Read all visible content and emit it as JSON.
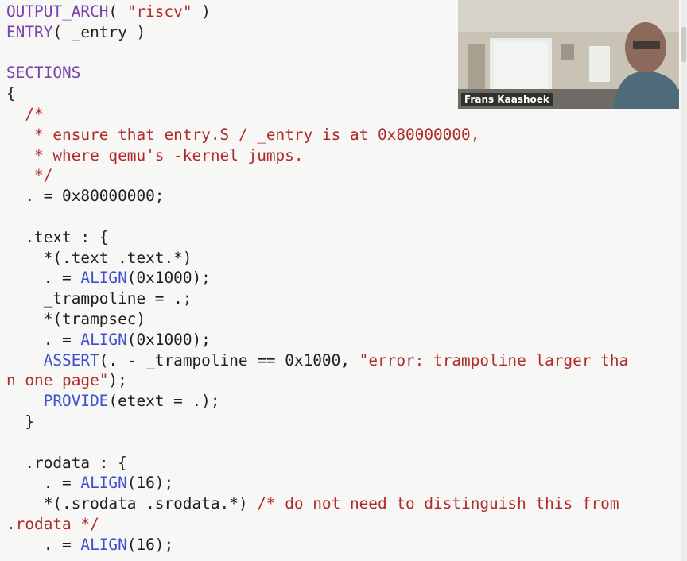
{
  "editor": {
    "lines": [
      {
        "id": 1,
        "parts": [
          {
            "t": "kw",
            "v": "OUTPUT_ARCH"
          },
          {
            "t": "plain",
            "v": "( "
          },
          {
            "t": "str",
            "v": "\"riscv\""
          },
          {
            "t": "plain",
            "v": " )"
          }
        ]
      },
      {
        "id": 2,
        "parts": [
          {
            "t": "kw",
            "v": "ENTRY"
          },
          {
            "t": "plain",
            "v": "( _entry )"
          }
        ]
      },
      {
        "id": 3,
        "parts": [
          {
            "t": "plain",
            "v": ""
          }
        ]
      },
      {
        "id": 4,
        "parts": [
          {
            "t": "kw",
            "v": "SECTIONS"
          }
        ]
      },
      {
        "id": 5,
        "parts": [
          {
            "t": "plain",
            "v": "{"
          }
        ]
      },
      {
        "id": 6,
        "parts": [
          {
            "t": "cm",
            "v": "  /*"
          }
        ]
      },
      {
        "id": 7,
        "parts": [
          {
            "t": "cm",
            "v": "   * ensure that entry.S / _entry is at 0x80000000,"
          }
        ]
      },
      {
        "id": 8,
        "parts": [
          {
            "t": "cm",
            "v": "   * where qemu's -kernel jumps."
          }
        ]
      },
      {
        "id": 9,
        "parts": [
          {
            "t": "cm",
            "v": "   */"
          }
        ]
      },
      {
        "id": 10,
        "parts": [
          {
            "t": "plain",
            "v": "  . = 0x80000000;"
          }
        ]
      },
      {
        "id": 11,
        "parts": [
          {
            "t": "plain",
            "v": ""
          }
        ]
      },
      {
        "id": 12,
        "parts": [
          {
            "t": "plain",
            "v": "  .text : {"
          }
        ]
      },
      {
        "id": 13,
        "parts": [
          {
            "t": "plain",
            "v": "    *(.text .text.*)"
          }
        ]
      },
      {
        "id": 14,
        "parts": [
          {
            "t": "plain",
            "v": "    . = "
          },
          {
            "t": "fn",
            "v": "ALIGN"
          },
          {
            "t": "plain",
            "v": "(0x1000);"
          }
        ]
      },
      {
        "id": 15,
        "parts": [
          {
            "t": "plain",
            "v": "    _trampoline = .;"
          }
        ]
      },
      {
        "id": 16,
        "parts": [
          {
            "t": "plain",
            "v": "    *(trampsec)"
          }
        ]
      },
      {
        "id": 17,
        "parts": [
          {
            "t": "plain",
            "v": "    . = "
          },
          {
            "t": "fn",
            "v": "ALIGN"
          },
          {
            "t": "plain",
            "v": "(0x1000);"
          }
        ]
      },
      {
        "id": 18,
        "parts": [
          {
            "t": "plain",
            "v": "    "
          },
          {
            "t": "fn",
            "v": "ASSERT"
          },
          {
            "t": "plain",
            "v": "(. - _trampoline == 0x1000, "
          },
          {
            "t": "str",
            "v": "\"error: trampoline larger tha"
          }
        ]
      },
      {
        "id": 19,
        "parts": [
          {
            "t": "str",
            "v": "n one page\""
          },
          {
            "t": "plain",
            "v": ");"
          }
        ]
      },
      {
        "id": 20,
        "parts": [
          {
            "t": "plain",
            "v": "    "
          },
          {
            "t": "fn",
            "v": "PROVIDE"
          },
          {
            "t": "plain",
            "v": "(etext = .);"
          }
        ]
      },
      {
        "id": 21,
        "parts": [
          {
            "t": "plain",
            "v": "  }"
          }
        ]
      },
      {
        "id": 22,
        "parts": [
          {
            "t": "plain",
            "v": ""
          }
        ]
      },
      {
        "id": 23,
        "parts": [
          {
            "t": "plain",
            "v": "  .rodata : {"
          }
        ]
      },
      {
        "id": 24,
        "parts": [
          {
            "t": "plain",
            "v": "    . = "
          },
          {
            "t": "fn",
            "v": "ALIGN"
          },
          {
            "t": "plain",
            "v": "(16);"
          }
        ]
      },
      {
        "id": 25,
        "parts": [
          {
            "t": "plain",
            "v": "    *(.srodata .srodata.*) "
          },
          {
            "t": "cm",
            "v": "/* do not need to distinguish this from"
          }
        ]
      },
      {
        "id": 26,
        "parts": [
          {
            "t": "cm",
            "v": ".rodata */"
          }
        ]
      },
      {
        "id": 27,
        "parts": [
          {
            "t": "plain",
            "v": "    . = "
          },
          {
            "t": "fn",
            "v": "ALIGN"
          },
          {
            "t": "plain",
            "v": "(16);"
          }
        ]
      }
    ]
  },
  "video": {
    "participant_name": "Frans Kaashoek"
  },
  "colors": {
    "keyword": "#7b3fb0",
    "function": "#3f4fd0",
    "string": "#b12a2a",
    "comment": "#b12a2a",
    "text": "#1e1e1e",
    "background": "#f7f7f5"
  }
}
